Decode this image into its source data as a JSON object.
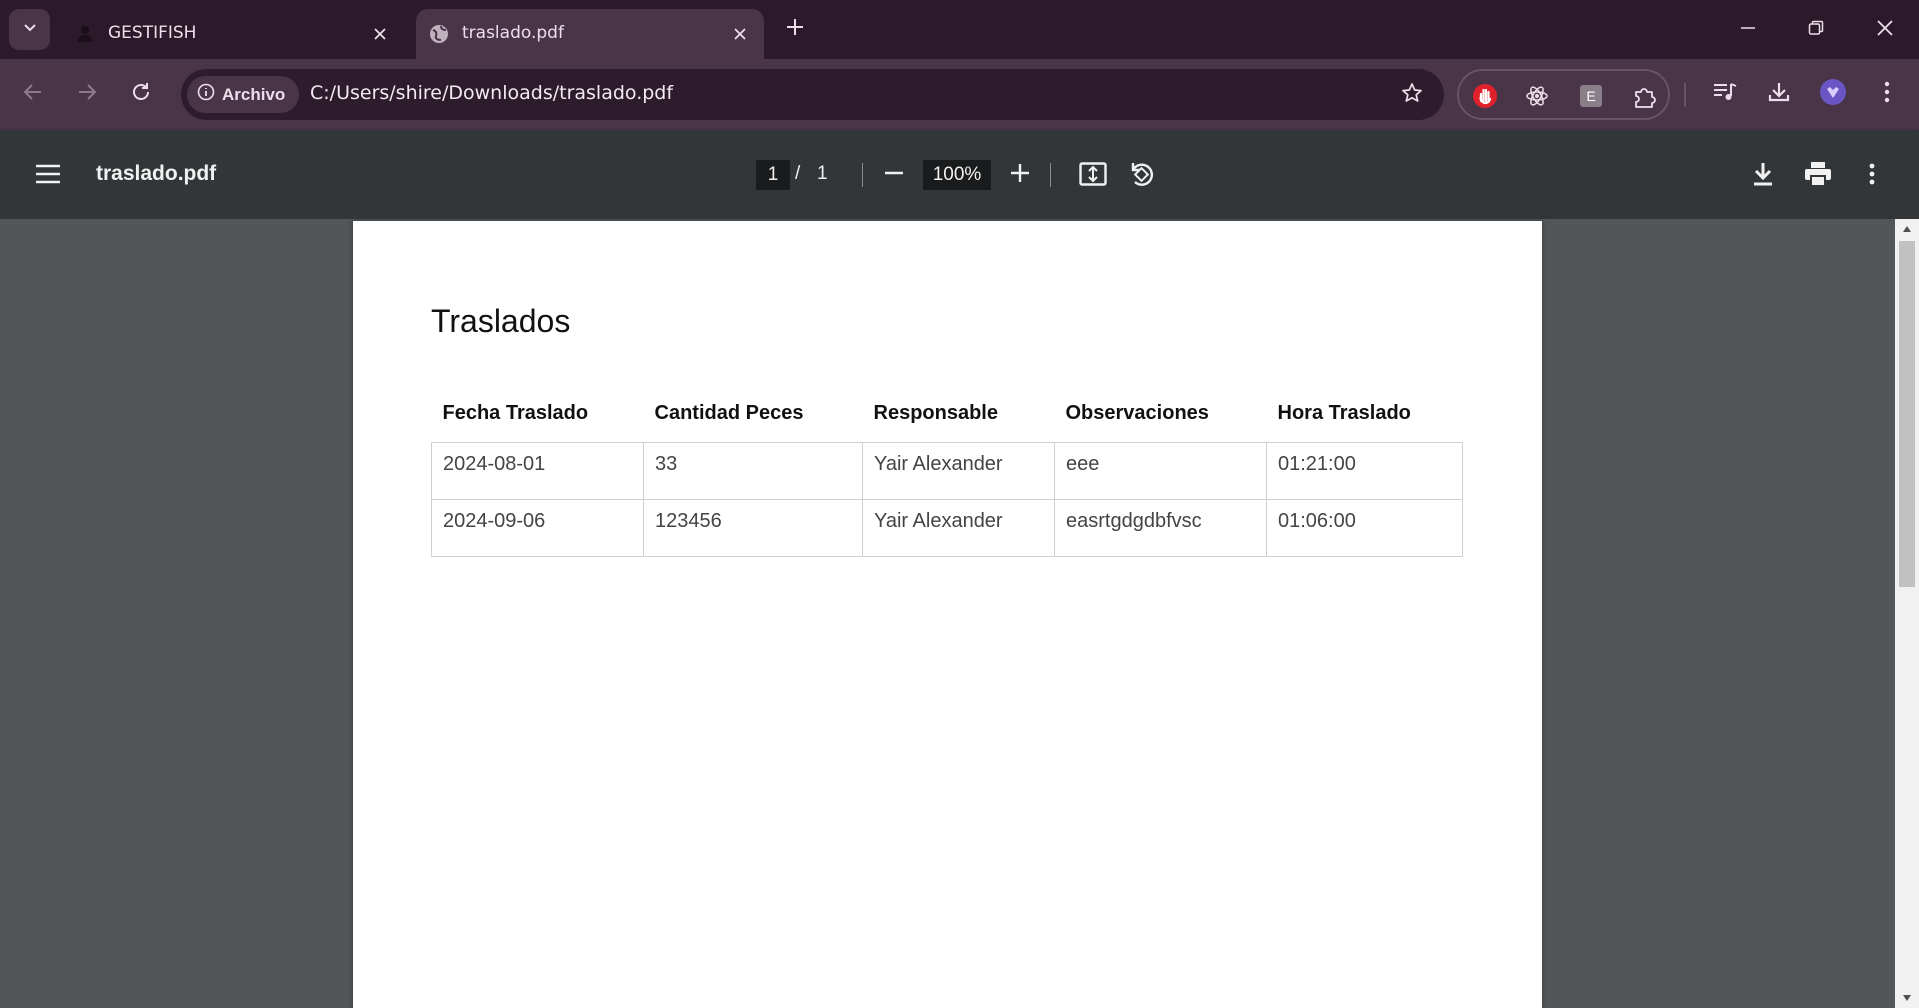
{
  "browser": {
    "tabs": [
      {
        "title": "GESTIFISH",
        "favicon": "person-icon",
        "active": false
      },
      {
        "title": "traslado.pdf",
        "favicon": "globe-icon",
        "active": true
      }
    ],
    "address": {
      "chip_label": "Archivo",
      "url": "C:/Users/shire/Downloads/traslado.pdf"
    },
    "extensions": [
      "stop-hand-icon",
      "atom-icon",
      "e-letter-icon",
      "puzzle-icon"
    ],
    "accent": "#4a3447"
  },
  "pdf_viewer": {
    "file_name": "traslado.pdf",
    "current_page": "1",
    "page_separator": "/",
    "total_pages": "1",
    "zoom": "100%"
  },
  "document": {
    "heading": "Traslados",
    "columns": [
      "Fecha Traslado",
      "Cantidad Peces",
      "Responsable",
      "Observaciones",
      "Hora Traslado"
    ],
    "rows": [
      [
        "2024-08-01",
        "33",
        "Yair Alexander",
        "eee",
        "01:21:00"
      ],
      [
        "2024-09-06",
        "123456",
        "Yair Alexander",
        "easrtgdgdbfvsc",
        "01:06:00"
      ]
    ]
  }
}
